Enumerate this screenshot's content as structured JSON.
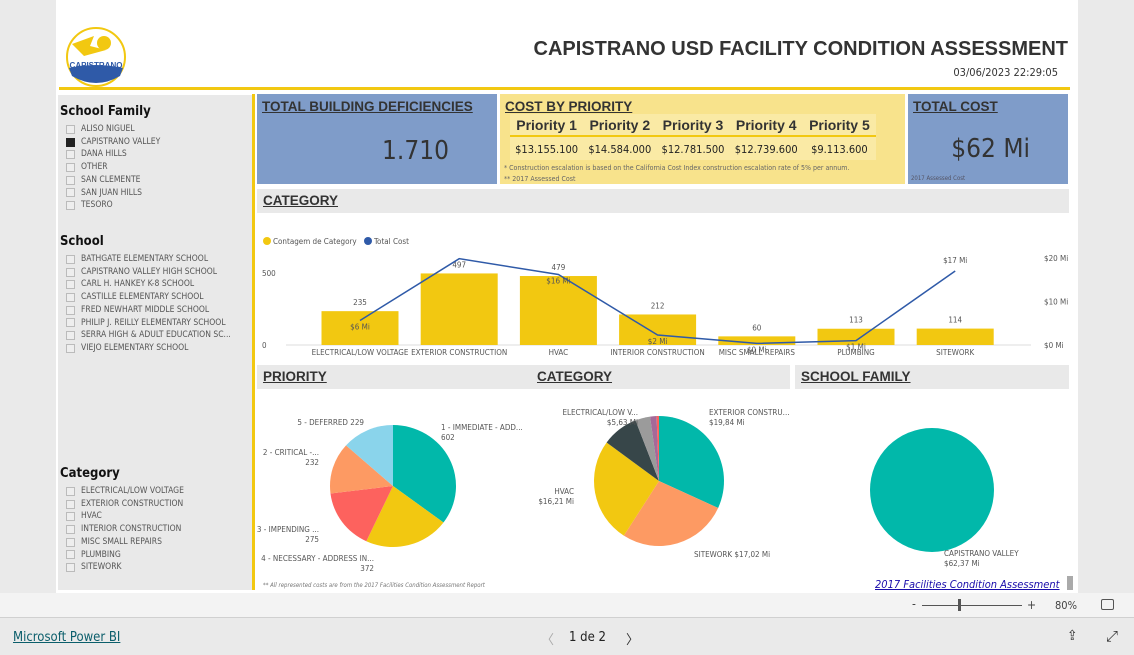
{
  "header": {
    "title": "CAPISTRANO USD FACILITY CONDITION ASSESSMENT",
    "timestamp": "03/06/2023 22:29:05",
    "logo_text": "CAPISTRANO",
    "logo_subtext": "UNIFIED SCHOOL DISTRICT"
  },
  "slicers": [
    {
      "title": "School Family",
      "items": [
        {
          "label": "ALISO NIGUEL",
          "checked": false
        },
        {
          "label": "CAPISTRANO VALLEY",
          "checked": true
        },
        {
          "label": "DANA HILLS",
          "checked": false
        },
        {
          "label": "OTHER",
          "checked": false
        },
        {
          "label": "SAN CLEMENTE",
          "checked": false
        },
        {
          "label": "SAN JUAN HILLS",
          "checked": false
        },
        {
          "label": "TESORO",
          "checked": false
        }
      ]
    },
    {
      "title": "School",
      "items": [
        {
          "label": "BATHGATE ELEMENTARY SCHOOL",
          "checked": false
        },
        {
          "label": "CAPISTRANO VALLEY HIGH SCHOOL",
          "checked": false
        },
        {
          "label": "CARL H. HANKEY K-8 SCHOOL",
          "checked": false
        },
        {
          "label": "CASTILLE ELEMENTARY SCHOOL",
          "checked": false
        },
        {
          "label": "FRED NEWHART MIDDLE SCHOOL",
          "checked": false
        },
        {
          "label": "PHILIP J. REILLY ELEMENTARY SCHOOL",
          "checked": false
        },
        {
          "label": "SERRA HIGH & ADULT EDUCATION SC...",
          "checked": false
        },
        {
          "label": "VIEJO ELEMENTARY SCHOOL",
          "checked": false
        }
      ]
    },
    {
      "title": "Category",
      "items": [
        {
          "label": "ELECTRICAL/LOW VOLTAGE",
          "checked": false
        },
        {
          "label": "EXTERIOR CONSTRUCTION",
          "checked": false
        },
        {
          "label": "HVAC",
          "checked": false
        },
        {
          "label": "INTERIOR CONSTRUCTION",
          "checked": false
        },
        {
          "label": "MISC SMALL REPAIRS",
          "checked": false
        },
        {
          "label": "PLUMBING",
          "checked": false
        },
        {
          "label": "SITEWORK",
          "checked": false
        }
      ]
    }
  ],
  "kpis": {
    "deficiencies": {
      "title": "TOTAL BUILDING DEFICIENCIES",
      "value": "1.710"
    },
    "cost_by_priority": {
      "title": "COST BY PRIORITY",
      "headers": [
        "Priority 1",
        "Priority 2",
        "Priority 3",
        "Priority 4",
        "Priority 5"
      ],
      "values": [
        "$13.155.100",
        "$14.584.000",
        "$12.781.500",
        "$12.739.600",
        "$9.113.600"
      ],
      "note1": "* Construction escalation is based on the California Cost Index construction escalation rate of 5% per annum.",
      "note2": "** 2017 Assessed Cost"
    },
    "total_cost": {
      "title": "TOTAL COST",
      "value": "$62 Mi",
      "note": "2017 Assessed Cost"
    }
  },
  "sections": {
    "category": "CATEGORY",
    "priority": "PRIORITY",
    "category2": "CATEGORY",
    "school_family": "SCHOOL FAMILY"
  },
  "colors": {
    "yellow": "#f2c811",
    "blue": "#2f5aa8",
    "card_blue": "#7f9cc9",
    "card_yellow": "#f8e38c",
    "teal": "#01b8aa",
    "orange": "#fd9a63",
    "red": "#fd625e",
    "lightblue": "#8ad4eb",
    "dark": "#374649",
    "gray": "#9b9b9b",
    "purple": "#a66999"
  },
  "chart_data": [
    {
      "type": "bar",
      "title": "",
      "legend": [
        "Contagem de Category",
        "Total Cost"
      ],
      "legend_position": "top-left",
      "categories": [
        "ELECTRICAL/LOW VOLTAGE",
        "EXTERIOR CONSTRUCTION",
        "HVAC",
        "INTERIOR CONSTRUCTION",
        "MISC SMALL REPAIRS",
        "PLUMBING",
        "SITEWORK"
      ],
      "series": [
        {
          "name": "Contagem de Category",
          "type": "bar",
          "values": [
            235,
            497,
            479,
            212,
            60,
            113,
            114
          ],
          "labels": [
            "235",
            "497",
            "479",
            "212",
            "60",
            "113",
            "114"
          ]
        },
        {
          "name": "Total Cost",
          "type": "line",
          "axis": "right",
          "values": [
            5.63,
            19.84,
            16.21,
            2.3,
            0.37,
            1.0,
            17.02
          ],
          "labels": [
            "$6 Mi",
            "",
            "$16 Mi",
            "$2 Mi",
            "$0 Mi",
            "$1 Mi",
            "$17 Mi"
          ]
        }
      ],
      "y_ticks": [
        "0",
        "500"
      ],
      "ylim": [
        0,
        600
      ],
      "y2_ticks": [
        "$0 Mi",
        "$10 Mi",
        "$20 Mi"
      ],
      "y2lim": [
        0,
        21
      ]
    },
    {
      "type": "pie",
      "title": "",
      "slices": [
        {
          "label": "1 - IMMEDIATE - ADD...",
          "value": 602,
          "color": "#01b8aa"
        },
        {
          "label": "4 - NECESSARY - ADDRESS IN...",
          "value": 372,
          "color": "#f2c811"
        },
        {
          "label": "3 - IMPENDING ...",
          "value": 275,
          "color": "#fd625e"
        },
        {
          "label": "2 - CRITICAL -...",
          "value": 232,
          "color": "#fd9a63"
        },
        {
          "label": "5 - DEFERRED",
          "value": 229,
          "color": "#8ad4eb"
        }
      ]
    },
    {
      "type": "pie",
      "title": "",
      "slices": [
        {
          "label": "EXTERIOR CONSTRU...",
          "value": 19.84,
          "display": "$19,84 Mi",
          "color": "#01b8aa"
        },
        {
          "label": "SITEWORK",
          "value": 17.02,
          "display": "$17,02 Mi",
          "color": "#fd9a63"
        },
        {
          "label": "HVAC",
          "value": 16.21,
          "display": "$16,21 Mi",
          "color": "#f2c811"
        },
        {
          "label": "ELECTRICAL/LOW V...",
          "value": 5.63,
          "display": "$5,63 Mi",
          "color": "#374649"
        },
        {
          "label": "",
          "value": 2.3,
          "display": "",
          "color": "#9b9b9b"
        },
        {
          "label": "",
          "value": 1.0,
          "display": "",
          "color": "#a66999"
        },
        {
          "label": "",
          "value": 0.37,
          "display": "",
          "color": "#fd625e"
        }
      ]
    },
    {
      "type": "pie",
      "title": "",
      "slices": [
        {
          "label": "CAPISTRANO VALLEY",
          "value": 62.37,
          "display": "$62,37 Mi",
          "color": "#01b8aa"
        }
      ]
    }
  ],
  "footnote": "** All represented costs are from the 2017 Facilities Condition Assessment Report",
  "link": "2017 Facilities Condition Assessment",
  "zoom": {
    "value": "80%",
    "minus": "-",
    "plus": "+",
    "level": 0.5
  },
  "footer": {
    "brand": "Microsoft Power BI",
    "page": "1 de 2",
    "prev": "〈",
    "next": "〉"
  }
}
